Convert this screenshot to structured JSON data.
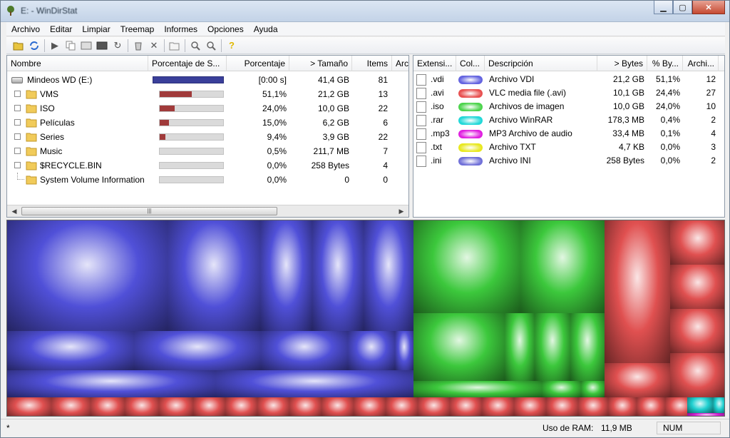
{
  "window": {
    "title": "E: - WinDirStat",
    "minimize_label": "▁",
    "maximize_label": "▢",
    "close_label": "✕"
  },
  "menu": [
    "Archivo",
    "Editar",
    "Limpiar",
    "Treemap",
    "Informes",
    "Opciones",
    "Ayuda"
  ],
  "toolbar_icons": [
    "open-icon",
    "refresh-icon",
    "play-icon",
    "copy-icon",
    "explorer-icon",
    "cmd-icon",
    "refresh-selected-icon",
    "delete-recycle-icon",
    "delete-icon",
    "properties-icon",
    "zoom-in-icon",
    "zoom-out-icon",
    "help-icon"
  ],
  "tree": {
    "columns": {
      "name": "Nombre",
      "subtree_pct": "Porcentaje de S...",
      "percentage": "Porcentaje",
      "size": "> Tamaño",
      "items": "Items",
      "files": "Arc"
    },
    "rows": [
      {
        "name": "Mindeos WD (E:)",
        "percentage": "[0:00 s]",
        "size": "41,4 GB",
        "items": "81",
        "fill": 1.0,
        "color": "#3a3f9a",
        "kind": "drive"
      },
      {
        "name": "VMS",
        "percentage": "51,1%",
        "size": "21,2 GB",
        "items": "13",
        "fill": 0.511,
        "color": "#a03a3a",
        "kind": "folder"
      },
      {
        "name": "ISO",
        "percentage": "24,0%",
        "size": "10,0 GB",
        "items": "22",
        "fill": 0.24,
        "color": "#a03a3a",
        "kind": "folder"
      },
      {
        "name": "Películas",
        "percentage": "15,0%",
        "size": "6,2 GB",
        "items": "6",
        "fill": 0.15,
        "color": "#a03a3a",
        "kind": "folder"
      },
      {
        "name": "Series",
        "percentage": "9,4%",
        "size": "3,9 GB",
        "items": "22",
        "fill": 0.094,
        "color": "#a03a3a",
        "kind": "folder"
      },
      {
        "name": "Music",
        "percentage": "0,5%",
        "size": "211,7 MB",
        "items": "7",
        "fill": 0.005,
        "color": "#a03a3a",
        "kind": "folder"
      },
      {
        "name": "$RECYCLE.BIN",
        "percentage": "0,0%",
        "size": "258 Bytes",
        "items": "4",
        "fill": 0.0,
        "color": "#a03a3a",
        "kind": "folder"
      },
      {
        "name": "System Volume Information",
        "percentage": "0,0%",
        "size": "0",
        "items": "0",
        "fill": 0.0,
        "color": "#a03a3a",
        "kind": "folder-leaf"
      }
    ]
  },
  "ext": {
    "columns": {
      "extension": "Extensi...",
      "color": "Col...",
      "description": "Descripción",
      "bytes": "> Bytes",
      "pct_bytes": "% By...",
      "files": "Archi..."
    },
    "rows": [
      {
        "ext": ".vdi",
        "swatch": "#6464e0",
        "description": "Archivo VDI",
        "bytes": "21,2 GB",
        "pct": "51,1%",
        "files": "12"
      },
      {
        "ext": ".avi",
        "swatch": "#e85050",
        "description": "VLC media file (.avi)",
        "bytes": "10,1 GB",
        "pct": "24,4%",
        "files": "27"
      },
      {
        "ext": ".iso",
        "swatch": "#4cd44c",
        "description": "Archivos de imagen",
        "bytes": "10,0 GB",
        "pct": "24,0%",
        "files": "10"
      },
      {
        "ext": ".rar",
        "swatch": "#22d8d8",
        "description": "Archivo WinRAR",
        "bytes": "178,3 MB",
        "pct": "0,4%",
        "files": "2"
      },
      {
        "ext": ".mp3",
        "swatch": "#e020e0",
        "description": "MP3 Archivo de audio",
        "bytes": "33,4 MB",
        "pct": "0,1%",
        "files": "4"
      },
      {
        "ext": ".txt",
        "swatch": "#e8e820",
        "description": "Archivo TXT",
        "bytes": "4,7 KB",
        "pct": "0,0%",
        "files": "3"
      },
      {
        "ext": ".ini",
        "swatch": "#7070d8",
        "description": "Archivo INI",
        "bytes": "258 Bytes",
        "pct": "0,0%",
        "files": "2"
      }
    ]
  },
  "colors": {
    "blue": "#5050d8",
    "green": "#3cc83c",
    "red": "#e05050",
    "cyan": "#20d0d0",
    "magenta": "#d020d0"
  },
  "status": {
    "left": "*",
    "ram_label": "Uso de RAM:",
    "ram_value": "11,9 MB",
    "num": "NUM"
  }
}
